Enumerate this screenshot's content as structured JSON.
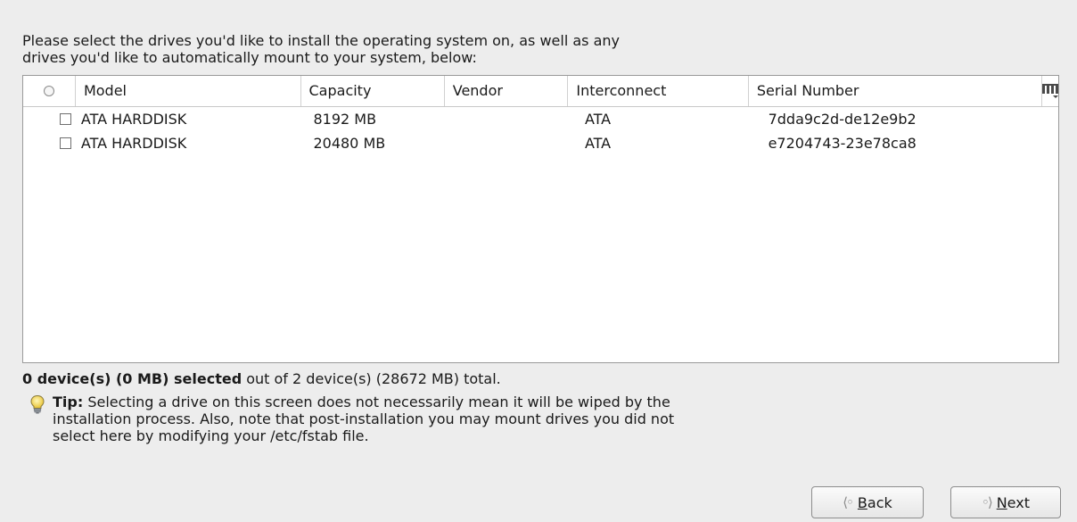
{
  "intro": {
    "line1": "Please select the drives you'd like to install the operating system on, as well as any",
    "line2": "drives you'd like to automatically mount to your system, below:"
  },
  "table": {
    "columns": {
      "model": "Model",
      "capacity": "Capacity",
      "vendor": "Vendor",
      "interconnect": "Interconnect",
      "serial": "Serial Number"
    },
    "column_chooser_icon": "column-chooser-icon",
    "rows": [
      {
        "model": "ATA HARDDISK",
        "capacity": "8192 MB",
        "vendor": "",
        "interconnect": "ATA",
        "serial": "7dda9c2d-de12e9b2",
        "checked": false
      },
      {
        "model": "ATA HARDDISK",
        "capacity": "20480 MB",
        "vendor": "",
        "interconnect": "ATA",
        "serial": "e7204743-23e78ca8",
        "checked": false
      }
    ]
  },
  "summary": {
    "selected": "0 device(s) (0 MB) selected",
    "total": " out of 2 device(s) (28672 MB) total."
  },
  "tip": {
    "icon": "lightbulb-icon",
    "label": "Tip:",
    "line1": " Selecting a drive on this screen does not necessarily mean it will be wiped by the",
    "line2": "installation process.  Also, note that post-installation you may mount drives you did not",
    "line3": "select here by modifying your /etc/fstab file."
  },
  "buttons": {
    "back": {
      "prefix": "",
      "mnemonic": "B",
      "rest": "ack",
      "icon": "back-arrow-icon"
    },
    "next": {
      "prefix": "",
      "mnemonic": "N",
      "rest": "ext",
      "icon": "forward-arrow-icon"
    }
  }
}
